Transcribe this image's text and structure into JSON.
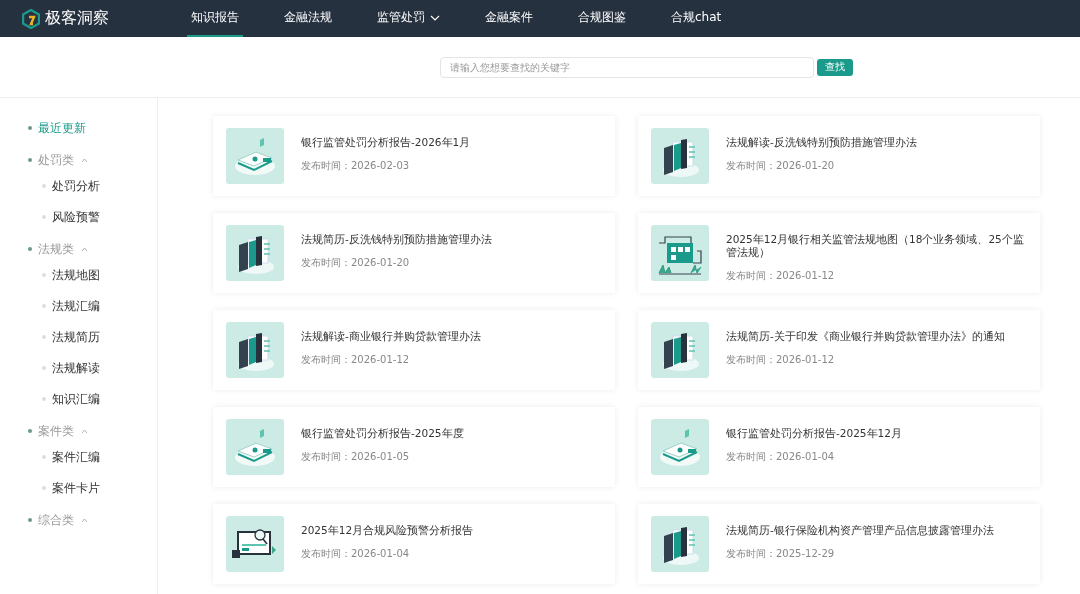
{
  "header": {
    "brand": "极客洞察",
    "nav": [
      {
        "label": "知识报告",
        "selected": true,
        "dropdown": false
      },
      {
        "label": "金融法规",
        "selected": false,
        "dropdown": false
      },
      {
        "label": "监管处罚",
        "selected": false,
        "dropdown": true
      },
      {
        "label": "金融案件",
        "selected": false,
        "dropdown": false
      },
      {
        "label": "合规图鉴",
        "selected": false,
        "dropdown": false
      },
      {
        "label": "合规chat",
        "selected": false,
        "dropdown": false
      }
    ]
  },
  "search": {
    "placeholder": "请输入您想要查找的关键字",
    "button": "查找"
  },
  "sidebar": {
    "items": [
      {
        "label": "最近更新",
        "selected": true
      },
      {
        "label": "处罚类",
        "selected": false,
        "expanded": true,
        "children": [
          {
            "label": "处罚分析",
            "selected": false
          },
          {
            "label": "风险预警",
            "selected": false
          }
        ]
      },
      {
        "label": "法规类",
        "selected": false,
        "expanded": true,
        "children": [
          {
            "label": "法规地图",
            "selected": false
          },
          {
            "label": "法规汇编",
            "selected": false
          },
          {
            "label": "法规简历",
            "selected": false
          },
          {
            "label": "法规解读",
            "selected": false
          },
          {
            "label": "知识汇编",
            "selected": false
          }
        ]
      },
      {
        "label": "案件类",
        "selected": false,
        "expanded": true,
        "children": [
          {
            "label": "案件汇编",
            "selected": false
          },
          {
            "label": "案件卡片",
            "selected": false
          }
        ]
      },
      {
        "label": "综合类",
        "selected": false,
        "expanded": true
      }
    ]
  },
  "cards": [
    {
      "kind": "report",
      "title": "银行监管处罚分析报告-2026年1月",
      "date": "发布时间：2026-02-03"
    },
    {
      "kind": "law",
      "title": "法规解读-反洗钱特别预防措施管理办法",
      "date": "发布时间：2026-01-20"
    },
    {
      "kind": "law",
      "title": "法规简历-反洗钱特别预防措施管理办法",
      "date": "发布时间：2026-01-20"
    },
    {
      "kind": "map",
      "title": "2025年12月银行相关监管法规地图（18个业务领域、25个监管法规）",
      "date": "发布时间：2026-01-12"
    },
    {
      "kind": "law",
      "title": "法规解读-商业银行并购贷款管理办法",
      "date": "发布时间：2026-01-12"
    },
    {
      "kind": "law",
      "title": "法规简历-关于印发《商业银行并购贷款管理办法》的通知",
      "date": "发布时间：2026-01-12"
    },
    {
      "kind": "report",
      "title": "银行监管处罚分析报告-2025年度",
      "date": "发布时间：2026-01-05"
    },
    {
      "kind": "report",
      "title": "银行监管处罚分析报告-2025年12月",
      "date": "发布时间：2026-01-04"
    },
    {
      "kind": "monitor",
      "title": "2025年12月合规风险预警分析报告",
      "date": "发布时间：2026-01-04"
    },
    {
      "kind": "law",
      "title": "法规简历-银行保险机构资产管理产品信息披露管理办法",
      "date": "发布时间：2025-12-29"
    }
  ]
}
